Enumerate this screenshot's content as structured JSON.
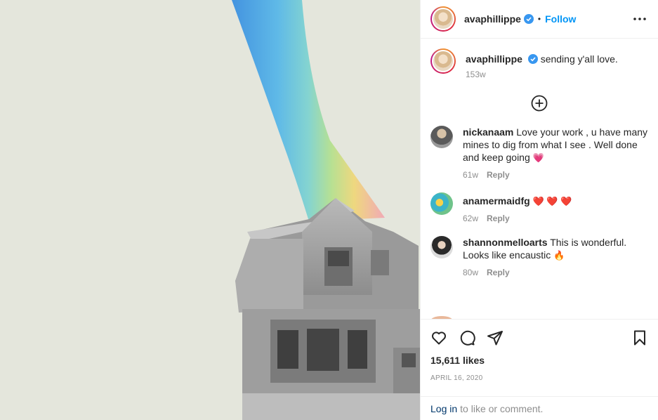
{
  "header": {
    "username": "avaphillippe",
    "dot": "•",
    "follow_label": "Follow",
    "more_icon": "more-horizontal-icon",
    "verified_icon": "verified-badge-icon"
  },
  "caption": {
    "username": "avaphillippe",
    "text": "sending y'all love.",
    "age": "153w"
  },
  "load_more_icon": "plus-circle-icon",
  "comments": [
    {
      "username": "nickanaam",
      "text": "Love your work , u have many mines to dig from what I see . Well done and keep going",
      "emoji": "💗",
      "age": "61w",
      "reply": "Reply"
    },
    {
      "username": "anamermaidfg",
      "text": "",
      "emoji": "❤️ ❤️ ❤️",
      "age": "62w",
      "reply": "Reply"
    },
    {
      "username": "shannonmelloarts",
      "text": "This is wonderful. Looks like encaustic",
      "emoji": "🔥",
      "age": "80w",
      "reply": "Reply"
    }
  ],
  "actions": {
    "like_icon": "heart-icon",
    "comment_icon": "comment-icon",
    "share_icon": "share-icon",
    "save_icon": "bookmark-icon"
  },
  "likes": "15,611 likes",
  "date": "APRIL 16, 2020",
  "login": {
    "link": "Log in",
    "rest": "to like or comment."
  },
  "colors": {
    "accent": "#0095f6",
    "verified": "#3897f0",
    "muted": "#8e8e8e",
    "canvas": "#e4e6dc"
  }
}
